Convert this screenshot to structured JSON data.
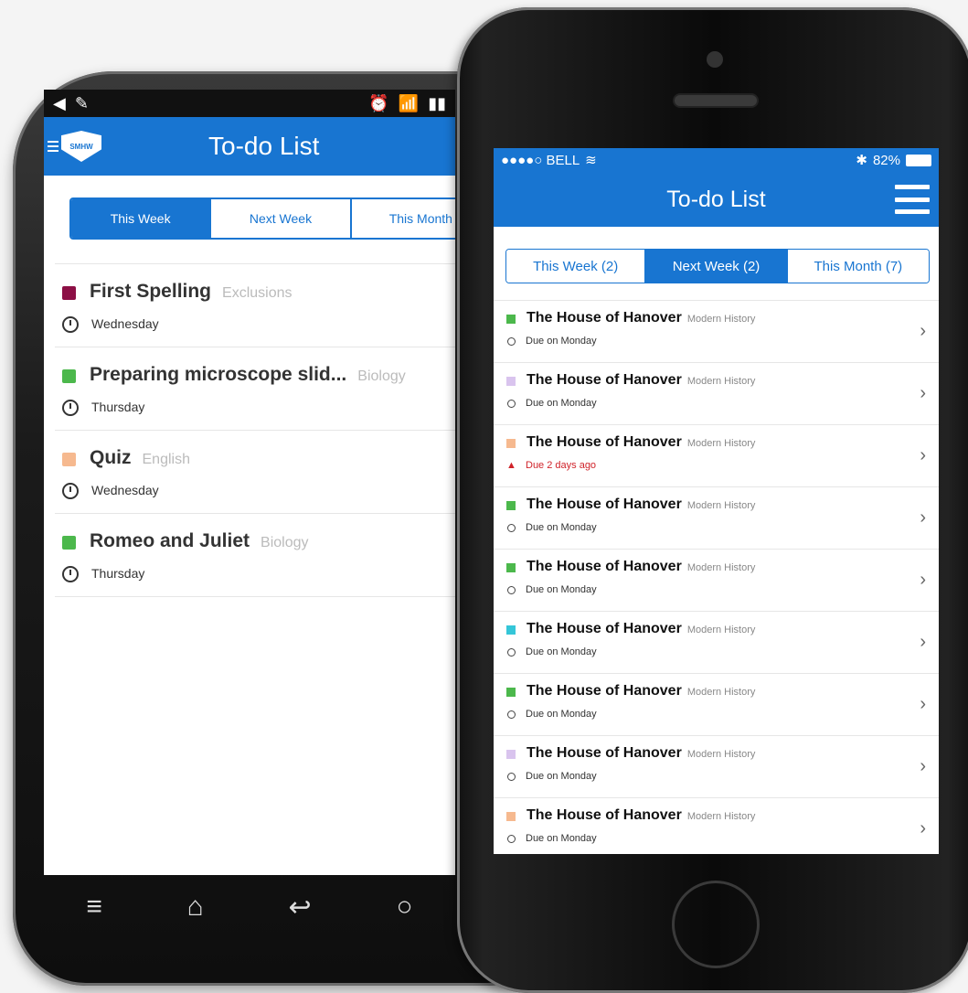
{
  "android": {
    "status_left": [
      "◀",
      "✎"
    ],
    "status_right": [
      "⏰",
      "📶",
      "▮▮"
    ],
    "logo_text": "SMHW",
    "title": "To-do List",
    "tabs": [
      "This Week",
      "Next Week",
      "This Month"
    ],
    "items": [
      {
        "title": "First Spelling",
        "subject": "Exclusions",
        "due": "Wednesday",
        "color": "#8c0f45"
      },
      {
        "title": "Preparing microscope slid...",
        "subject": "Biology",
        "due": "Thursday",
        "color": "#4cb84c"
      },
      {
        "title": "Quiz",
        "subject": "English",
        "due": "Wednesday",
        "color": "#f6b98f"
      },
      {
        "title": "Romeo and Juliet",
        "subject": "Biology",
        "due": "Thursday",
        "color": "#4cb84c"
      }
    ],
    "nav": [
      "≡",
      "⌂",
      "↩",
      "○"
    ]
  },
  "iphone": {
    "carrier": "●●●●○ BELL",
    "wifi": "≋",
    "bluetooth": "✱",
    "battery": "82%",
    "title": "To-do List",
    "tabs": [
      "This Week (2)",
      "Next Week (2)",
      "This Month (7)"
    ],
    "items": [
      {
        "title": "The House of Hanover",
        "subject": "Modern History",
        "due": "Due on Monday",
        "color": "#4cb84c",
        "overdue": false
      },
      {
        "title": "The House of Hanover",
        "subject": "Modern History",
        "due": "Due on Monday",
        "color": "#d9c4ee",
        "overdue": false
      },
      {
        "title": "The House of Hanover",
        "subject": "Modern History",
        "due": "Due 2 days ago",
        "color": "#f6b98f",
        "overdue": true
      },
      {
        "title": "The House of Hanover",
        "subject": "Modern History",
        "due": "Due on Monday",
        "color": "#4cb84c",
        "overdue": false
      },
      {
        "title": "The House of Hanover",
        "subject": "Modern History",
        "due": "Due on Monday",
        "color": "#4cb84c",
        "overdue": false
      },
      {
        "title": "The House of Hanover",
        "subject": "Modern History",
        "due": "Due on Monday",
        "color": "#35c6d8",
        "overdue": false
      },
      {
        "title": "The House of Hanover",
        "subject": "Modern History",
        "due": "Due on Monday",
        "color": "#4cb84c",
        "overdue": false
      },
      {
        "title": "The House of Hanover",
        "subject": "Modern History",
        "due": "Due on Monday",
        "color": "#d9c4ee",
        "overdue": false
      },
      {
        "title": "The House of Hanover",
        "subject": "Modern History",
        "due": "Due on Monday",
        "color": "#f6b98f",
        "overdue": false
      }
    ],
    "chevron": "›"
  },
  "colors": {
    "brand_blue": "#1875d1",
    "overdue_red": "#d0232a"
  }
}
